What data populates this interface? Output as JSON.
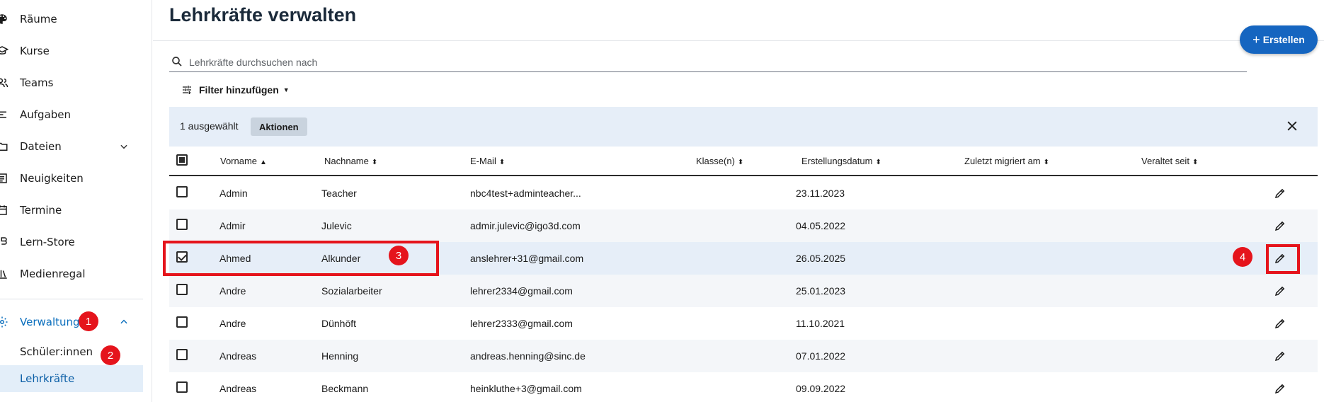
{
  "sidebar": {
    "items": [
      {
        "label": "Räume",
        "icon": "palette-icon"
      },
      {
        "label": "Kurse",
        "icon": "school-icon"
      },
      {
        "label": "Teams",
        "icon": "people-icon"
      },
      {
        "label": "Aufgaben",
        "icon": "tasks-icon"
      },
      {
        "label": "Dateien",
        "icon": "folder-icon"
      },
      {
        "label": "Neuigkeiten",
        "icon": "news-icon"
      },
      {
        "label": "Termine",
        "icon": "calendar-icon"
      },
      {
        "label": "Lern-Store",
        "icon": "store-icon"
      },
      {
        "label": "Medienregal",
        "icon": "media-shelf-icon"
      },
      {
        "label": "Verwaltung",
        "icon": "gear-icon"
      }
    ],
    "sub_items": [
      {
        "label": "Schüler:innen"
      },
      {
        "label": "Lehrkräfte"
      }
    ]
  },
  "header": {
    "title": "Lehrkräfte verwalten",
    "create_label": "Erstellen"
  },
  "search": {
    "placeholder": "Lehrkräfte durchsuchen nach"
  },
  "filter": {
    "label": "Filter hinzufügen"
  },
  "selection": {
    "count_text": "1 ausgewählt",
    "actions_label": "Aktionen"
  },
  "table": {
    "columns": [
      "Vorname",
      "Nachname",
      "E-Mail",
      "Klasse(n)",
      "Erstellungsdatum",
      "Zuletzt migriert am",
      "Veraltet seit"
    ],
    "rows": [
      {
        "vorname": "Admin",
        "nachname": "Teacher",
        "email": "nbc4test+adminteacher...",
        "klassen": "",
        "datum": "23.11.2023",
        "migriert": "",
        "veraltet": "",
        "checked": false
      },
      {
        "vorname": "Admir",
        "nachname": "Julevic",
        "email": "admir.julevic@igo3d.com",
        "klassen": "",
        "datum": "04.05.2022",
        "migriert": "",
        "veraltet": "",
        "checked": false
      },
      {
        "vorname": "Ahmed",
        "nachname": "Alkunder",
        "email": "anslehrer+31@gmail.com",
        "klassen": "",
        "datum": "26.05.2025",
        "migriert": "",
        "veraltet": "",
        "checked": true
      },
      {
        "vorname": "Andre",
        "nachname": "Sozialarbeiter",
        "email": "lehrer2334@gmail.com",
        "klassen": "",
        "datum": "25.01.2023",
        "migriert": "",
        "veraltet": "",
        "checked": false
      },
      {
        "vorname": "Andre",
        "nachname": "Dünhöft",
        "email": "lehrer2333@gmail.com",
        "klassen": "",
        "datum": "11.10.2021",
        "migriert": "",
        "veraltet": "",
        "checked": false
      },
      {
        "vorname": "Andreas",
        "nachname": "Henning",
        "email": "andreas.henning@sinc.de",
        "klassen": "",
        "datum": "07.01.2022",
        "migriert": "",
        "veraltet": "",
        "checked": false
      },
      {
        "vorname": "Andreas",
        "nachname": "Beckmann",
        "email": "heinkluthe+3@gmail.com",
        "klassen": "",
        "datum": "09.09.2022",
        "migriert": "",
        "veraltet": "",
        "checked": false
      }
    ]
  },
  "annotations": [
    "1",
    "2",
    "3",
    "4"
  ],
  "colors": {
    "primary": "#1565c0",
    "active_nav": "#0a6ebd",
    "selection_bg": "#e6eef8",
    "annotation_red": "#e5141c"
  }
}
